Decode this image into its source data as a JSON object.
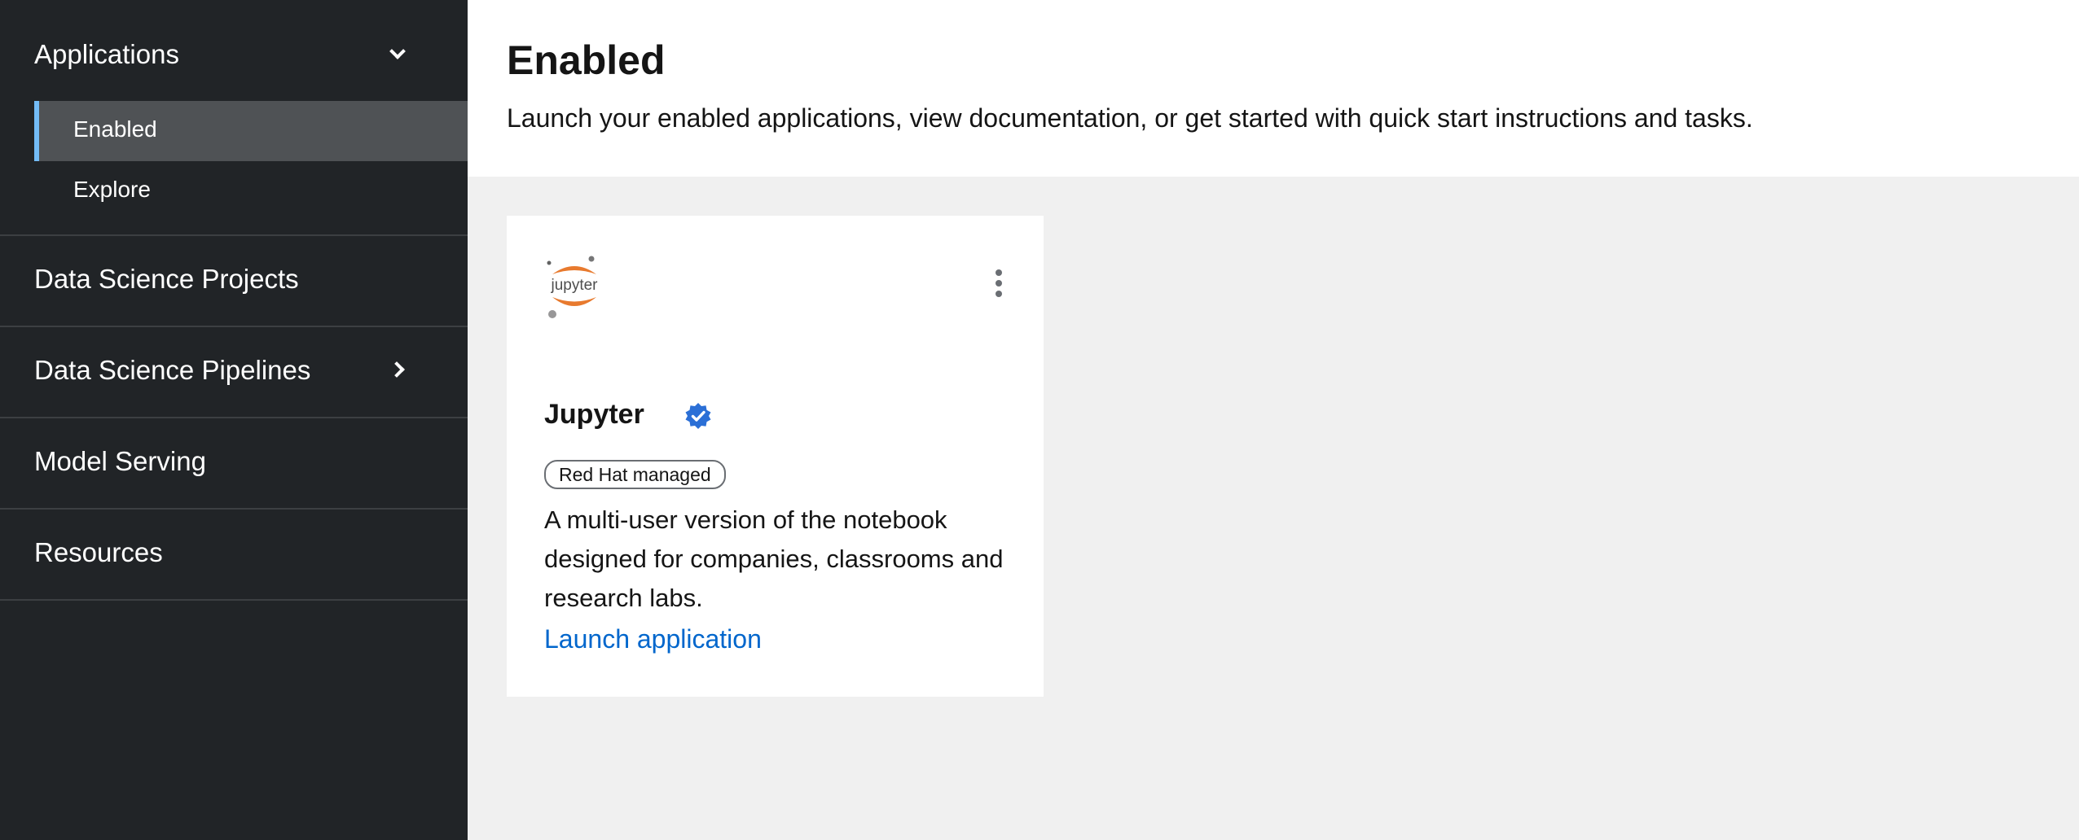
{
  "sidebar": {
    "applications": {
      "label": "Applications",
      "expanded_icon": "chevron-down-icon",
      "items": [
        {
          "label": "Enabled",
          "active": true
        },
        {
          "label": "Explore",
          "active": false
        }
      ]
    },
    "items": [
      {
        "label": "Data Science Projects",
        "icon": ""
      },
      {
        "label": "Data Science Pipelines",
        "icon": "chevron-right-icon"
      },
      {
        "label": "Model Serving",
        "icon": ""
      },
      {
        "label": "Resources",
        "icon": ""
      }
    ],
    "colors": {
      "background": "#212427",
      "active_background": "#4f5255",
      "active_indicator": "#73bcf7"
    }
  },
  "header": {
    "title": "Enabled",
    "description": "Launch your enabled applications, view documentation, or get started with quick start instructions and tasks."
  },
  "card": {
    "logo_text": "jupyter",
    "logo_icon": "jupyter-logo",
    "menu_icon": "kebab-icon",
    "title": "Jupyter",
    "verified_icon": "verified-check-icon",
    "badge": "Red Hat managed",
    "description": "A multi-user version of the notebook designed for companies, classrooms and research labs.",
    "launch_label": "Launch application",
    "colors": {
      "link": "#0066cc",
      "verified": "#2b6fd6",
      "logo_orange": "#e87a2e"
    }
  }
}
